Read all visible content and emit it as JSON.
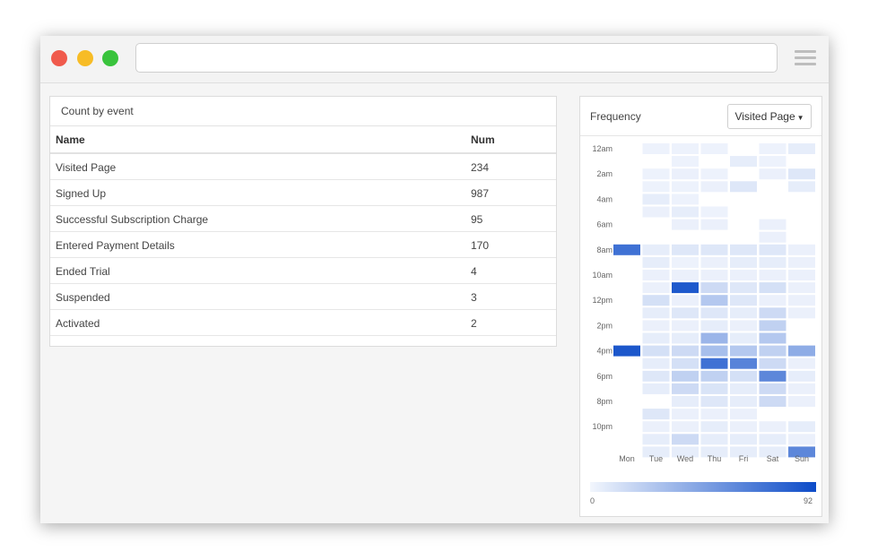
{
  "browser": {
    "url": "",
    "controls": [
      "close",
      "minimize",
      "maximize"
    ],
    "menu_icon": "hamburger-menu-icon"
  },
  "count_panel": {
    "title": "Count by event",
    "columns": [
      "Name",
      "Num"
    ],
    "rows": [
      {
        "name": "Visited Page",
        "num": "234"
      },
      {
        "name": "Signed Up",
        "num": "987"
      },
      {
        "name": "Successful Subscription Charge",
        "num": "95"
      },
      {
        "name": "Entered Payment Details",
        "num": "170"
      },
      {
        "name": "Ended Trial",
        "num": "4"
      },
      {
        "name": "Suspended",
        "num": "3"
      },
      {
        "name": "Activated",
        "num": "2"
      }
    ]
  },
  "frequency_panel": {
    "title": "Frequency",
    "dropdown_selected": "Visited Page"
  },
  "chart_data": {
    "type": "heatmap",
    "x_labels": [
      "Mon",
      "Tue",
      "Wed",
      "Thu",
      "Fri",
      "Sat",
      "Sun"
    ],
    "y_tick_labels": [
      "12am",
      "2am",
      "4am",
      "6am",
      "8am",
      "10am",
      "12pm",
      "2pm",
      "4pm",
      "6pm",
      "8pm",
      "10pm"
    ],
    "scale_min": 0,
    "scale_max": 92,
    "color_low": "#f2f6fd",
    "color_high": "#0d4cc8",
    "values": [
      [
        0,
        2,
        2,
        2,
        0,
        2,
        5
      ],
      [
        0,
        0,
        2,
        0,
        5,
        2,
        0
      ],
      [
        0,
        2,
        3,
        2,
        0,
        3,
        8
      ],
      [
        0,
        2,
        2,
        3,
        8,
        0,
        5
      ],
      [
        0,
        5,
        2,
        0,
        0,
        0,
        0
      ],
      [
        0,
        3,
        5,
        2,
        0,
        0,
        0
      ],
      [
        0,
        0,
        3,
        3,
        0,
        3,
        0
      ],
      [
        0,
        0,
        0,
        0,
        0,
        3,
        0
      ],
      [
        72,
        5,
        8,
        8,
        8,
        8,
        3
      ],
      [
        0,
        5,
        2,
        3,
        5,
        5,
        3
      ],
      [
        0,
        3,
        3,
        3,
        3,
        3,
        3
      ],
      [
        0,
        3,
        85,
        15,
        8,
        12,
        3
      ],
      [
        0,
        12,
        3,
        25,
        8,
        3,
        3
      ],
      [
        0,
        5,
        8,
        8,
        5,
        15,
        3
      ],
      [
        0,
        3,
        3,
        5,
        3,
        20,
        0
      ],
      [
        0,
        5,
        5,
        35,
        5,
        25,
        0
      ],
      [
        86,
        12,
        15,
        30,
        25,
        20,
        40
      ],
      [
        0,
        5,
        12,
        72,
        62,
        15,
        3
      ],
      [
        0,
        8,
        20,
        20,
        12,
        60,
        5
      ],
      [
        0,
        5,
        15,
        10,
        5,
        15,
        3
      ],
      [
        0,
        0,
        5,
        8,
        5,
        15,
        3
      ],
      [
        0,
        8,
        3,
        3,
        3,
        0,
        0
      ],
      [
        0,
        3,
        3,
        5,
        3,
        3,
        5
      ],
      [
        0,
        5,
        15,
        5,
        5,
        5,
        3
      ],
      [
        0,
        5,
        5,
        5,
        5,
        5,
        60
      ]
    ]
  }
}
